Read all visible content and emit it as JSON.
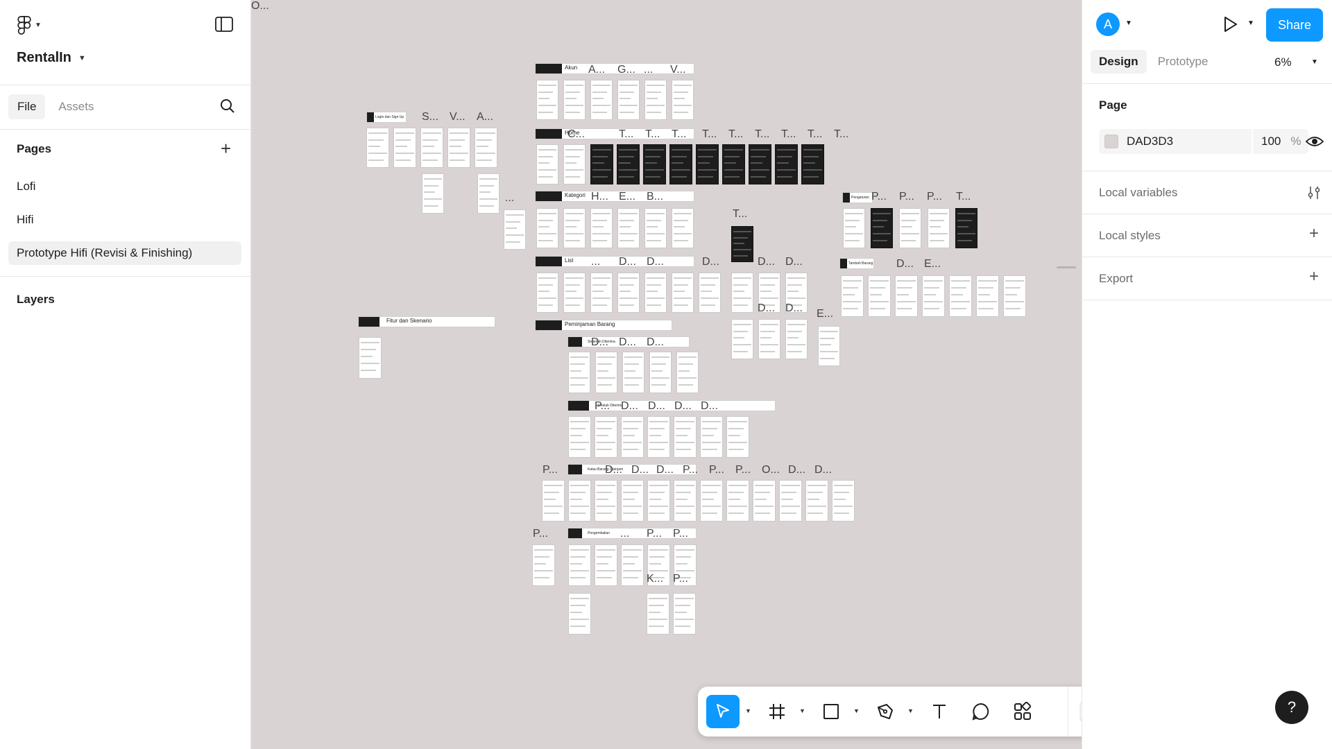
{
  "file": {
    "name": "RentalIn"
  },
  "left_tabs": {
    "file": "File",
    "assets": "Assets"
  },
  "pages": {
    "title": "Pages",
    "items": [
      {
        "label": "Lofi"
      },
      {
        "label": "Hifi"
      },
      {
        "label": "Prototype Hifi (Revisi & Finishing)"
      }
    ],
    "selected": "Prototype Hifi (Revisi & Finishing)"
  },
  "layers": {
    "title": "Layers"
  },
  "canvas": {
    "background": "#DAD3D3",
    "sections": [
      {
        "label": "Akun"
      },
      {
        "label": "Home"
      },
      {
        "label": "Kategori"
      },
      {
        "label": "List"
      },
      {
        "label": "Peminjaman Barang"
      },
      {
        "label": "Fitur dan Skenario"
      },
      {
        "label": "Login dan Sign Up"
      },
      {
        "label": "Pengaturan"
      },
      {
        "label": "Tambah Barang"
      },
      {
        "label": "Sebelum Diterima"
      },
      {
        "label": "Setelah Diterima"
      },
      {
        "label": "Kalau Barang Dipinjam"
      },
      {
        "label": "Pengembalian"
      }
    ],
    "frame_labels": [
      "S...",
      "V...",
      "A...",
      "A...",
      "G...",
      "...",
      "V...",
      "C...",
      "T...",
      "T...",
      "T...",
      "T...",
      "T...",
      "T...",
      "T...",
      "T...",
      "T...",
      "...",
      "H...",
      "E...",
      "B...",
      "T...",
      "P...",
      "P...",
      "P...",
      "T...",
      "...",
      "D...",
      "D...",
      "D...",
      "D...",
      "D...",
      "D...",
      "D...",
      "D...",
      "E...",
      "E...",
      "D...",
      "D...",
      "D...",
      "P...",
      "D...",
      "D...",
      "D...",
      "D...",
      "P...",
      "D...",
      "D...",
      "D...",
      "P...",
      "P...",
      "P...",
      "O...",
      "D...",
      "D...",
      "P...",
      "...",
      "P...",
      "P...",
      "K...",
      "P...",
      "O..."
    ]
  },
  "toolbar": {
    "tools": [
      "move-tool",
      "frame-tool",
      "shape-tool",
      "pen-tool",
      "text-tool",
      "comment-tool",
      "actions-tool",
      "dev-mode-toggle"
    ]
  },
  "right": {
    "avatar_initial": "A",
    "share_label": "Share",
    "tabs": {
      "design": "Design",
      "prototype": "Prototype"
    },
    "zoom": "6%",
    "page_section": {
      "title": "Page",
      "color_hex": "DAD3D3",
      "opacity": "100",
      "opacity_unit": "%"
    },
    "rows": {
      "local_variables": "Local variables",
      "local_styles": "Local styles",
      "export": "Export"
    },
    "help": "?"
  },
  "colors": {
    "accent": "#0D99FF",
    "canvas": "#DAD3D3",
    "dark_frame": "#1D1D1D"
  }
}
